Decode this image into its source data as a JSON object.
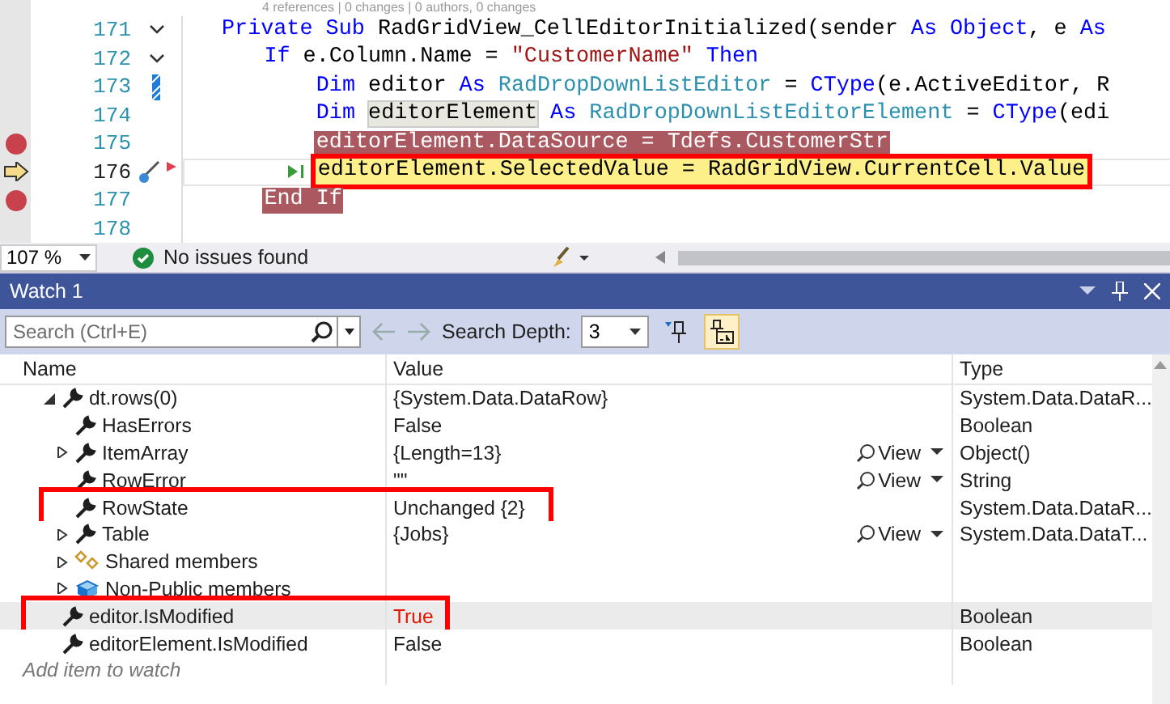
{
  "editor": {
    "code_lens": "4 references | 0 changes | 0 authors, 0 changes",
    "lines": [
      {
        "number": "171",
        "fold": true,
        "breakpoint": false,
        "current": false,
        "changed": false,
        "annotated": false,
        "segments": [
          {
            "text": "Private Sub",
            "kind": "keyword"
          },
          {
            "text": " RadGridView_CellEditorInitialized(sender ",
            "kind": "plain"
          },
          {
            "text": "As Object",
            "kind": "keyword"
          },
          {
            "text": ", e ",
            "kind": "plain"
          },
          {
            "text": "As",
            "kind": "keyword"
          }
        ],
        "children": [
          {
            "number": "172",
            "fold": true,
            "breakpoint": false,
            "current": false,
            "changed": false,
            "annotated": false,
            "segments": [
              {
                "text": "If",
                "kind": "keyword"
              },
              {
                "text": " e.Column.Name = ",
                "kind": "plain"
              },
              {
                "text": "\"CustomerName\"",
                "kind": "string"
              },
              {
                "text": " Then",
                "kind": "keyword"
              }
            ],
            "children": [
              {
                "number": "173",
                "fold": false,
                "breakpoint": false,
                "current": false,
                "changed": true,
                "annotated": false,
                "segments": [
                  {
                    "text": "Dim",
                    "kind": "keyword"
                  },
                  {
                    "text": " editor ",
                    "kind": "plain"
                  },
                  {
                    "text": "As",
                    "kind": "keyword"
                  },
                  {
                    "text": " RadDropDownListEditor",
                    "kind": "type"
                  },
                  {
                    "text": " = ",
                    "kind": "plain"
                  },
                  {
                    "text": "CType",
                    "kind": "keyword"
                  },
                  {
                    "text": "(e.ActiveEditor, R",
                    "kind": "plain"
                  }
                ]
              },
              {
                "number": "174",
                "fold": false,
                "breakpoint": false,
                "current": false,
                "changed": false,
                "annotated": false,
                "segments": [
                  {
                    "text": "Dim ",
                    "kind": "keyword"
                  },
                  {
                    "text": "editorElement",
                    "kind": "reference"
                  },
                  {
                    "text": " As",
                    "kind": "keyword"
                  },
                  {
                    "text": " RadDropDownListEditorElement",
                    "kind": "type"
                  },
                  {
                    "text": " = ",
                    "kind": "plain"
                  },
                  {
                    "text": "CType",
                    "kind": "keyword"
                  },
                  {
                    "text": "(edi",
                    "kind": "plain"
                  }
                ]
              },
              {
                "number": "175",
                "fold": false,
                "breakpoint": true,
                "current": false,
                "changed": false,
                "annotated": false,
                "segments": [
                  {
                    "text": "editorElement.DataSource = Tdefs.CustomerStr",
                    "kind": "plain"
                  }
                ]
              },
              {
                "number": "176",
                "fold": false,
                "breakpoint": false,
                "current": true,
                "changed": false,
                "annotated": true,
                "segments": [
                  {
                    "text": "editorElement.SelectedValue = RadGridView.CurrentCell.Value",
                    "kind": "plain"
                  }
                ]
              }
            ]
          },
          {
            "number": "177",
            "fold": false,
            "breakpoint": true,
            "current": false,
            "changed": false,
            "annotated": false,
            "segments": [
              {
                "text": "End If",
                "kind": "keyword"
              }
            ]
          },
          {
            "number": "178",
            "fold": false,
            "breakpoint": false,
            "current": false,
            "changed": false
          }
        ]
      }
    ]
  },
  "status_bar": {
    "zoom": "107 %",
    "issues": "No issues found"
  },
  "watch": {
    "title": "Watch 1",
    "toolbar": {
      "search": {
        "placeholder": "Search (Ctrl+E)"
      },
      "depth_label": "Search Depth:",
      "depth": "3",
      "raw_view_on": true
    },
    "columns": [
      "Name",
      "Value",
      "Type"
    ],
    "rows": [
      {
        "name": "dt.rows(0)",
        "value": "{System.Data.DataRow}",
        "type": "System.Data.DataR...",
        "kind": "property",
        "expanded": true,
        "selected": false,
        "changed": false,
        "annotated": false,
        "children": [
          {
            "name": "HasErrors",
            "value": "False",
            "type": "Boolean",
            "kind": "property",
            "selected": false,
            "changed": false,
            "annotated": false
          },
          {
            "name": "ItemArray",
            "value": "{Length=13}",
            "type": "Object()",
            "kind": "property",
            "expanded": false,
            "view": "View",
            "selected": false,
            "changed": false,
            "annotated": false
          },
          {
            "name": "RowError",
            "value": "\"\"",
            "type": "String",
            "kind": "property",
            "view": "View",
            "selected": false,
            "changed": false,
            "annotated": false
          },
          {
            "name": "RowState",
            "value": "Unchanged {2}",
            "type": "System.Data.DataR...",
            "kind": "property",
            "selected": false,
            "changed": false,
            "annotated": true
          },
          {
            "name": "Table",
            "value": "{Jobs}",
            "type": "System.Data.DataT...",
            "kind": "property",
            "expanded": false,
            "view": "View",
            "selected": false,
            "changed": false,
            "annotated": false
          },
          {
            "name": "Shared members",
            "kind": "shared",
            "expanded": false,
            "selected": false,
            "annotated": false
          },
          {
            "name": "Non-Public members",
            "kind": "nonpublic",
            "expanded": false,
            "selected": false,
            "annotated": false
          }
        ]
      },
      {
        "name": "editor.IsModified",
        "value": "True",
        "type": "Boolean",
        "kind": "property",
        "selected": true,
        "changed": true,
        "annotated": true
      },
      {
        "name": "editorElement.IsModified",
        "value": "False",
        "type": "Boolean",
        "kind": "property",
        "selected": false,
        "changed": false,
        "annotated": false
      }
    ],
    "add_placeholder": "Add item to watch"
  }
}
